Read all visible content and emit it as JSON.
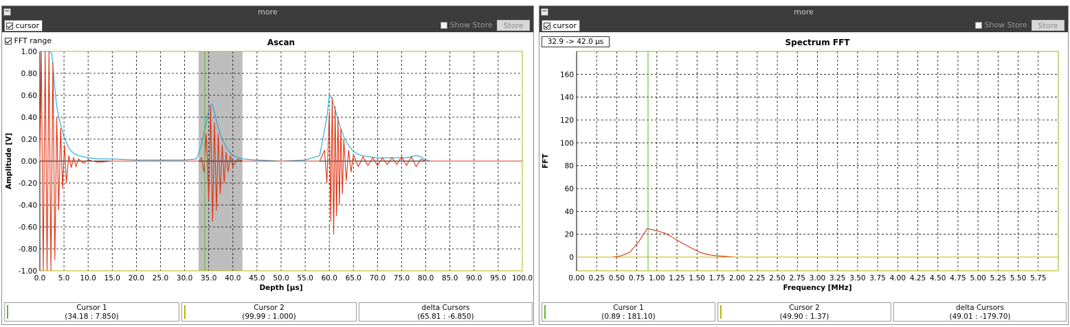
{
  "left_panel": {
    "title": "more",
    "cursor_checkbox": "cursor",
    "show_store": "Show Store",
    "store_button": "Store",
    "fft_range_label": "FFT range",
    "status": [
      {
        "label": "Cursor 1",
        "value": "(34.18 : 7.850)"
      },
      {
        "label": "Cursor 2",
        "value": "(99.99 : 1.000)"
      },
      {
        "label": "delta Cursors",
        "value": "(65.81 : -6.850)"
      }
    ]
  },
  "right_panel": {
    "title": "more",
    "cursor_checkbox": "cursor",
    "show_store": "Show Store",
    "store_button": "Store",
    "range_display": "32.9 -> 42.0 µs",
    "status": [
      {
        "label": "Cursor 1",
        "value": "(0.89 : 181.10)"
      },
      {
        "label": "Cursor 2",
        "value": "(49.90 : 1.37)"
      },
      {
        "label": "delta Cursors",
        "value": "(49.01 : -179.70)"
      }
    ]
  },
  "colors": {
    "trace": "#e03010",
    "envelope": "#1aa7d8",
    "cursor": "#5cb82a",
    "range_shade": "#bdbdbd",
    "frame": "#b7b700"
  },
  "chart_data": [
    {
      "type": "line",
      "title": "Ascan",
      "xlabel": "Depth [µs]",
      "ylabel": "Amplitude [V]",
      "xlim": [
        0,
        100
      ],
      "ylim": [
        -1,
        1
      ],
      "x_ticks": [
        "0.0",
        "5.0",
        "10.0",
        "15.0",
        "20.0",
        "25.0",
        "30.0",
        "35.0",
        "40.0",
        "45.0",
        "50.0",
        "55.0",
        "60.0",
        "65.0",
        "70.0",
        "75.0",
        "80.0",
        "85.0",
        "90.0",
        "95.0",
        "100.0"
      ],
      "y_ticks": [
        "1.00",
        "0.80",
        "0.60",
        "0.40",
        "0.20",
        "0.00",
        "-0.20",
        "-0.40",
        "-0.60",
        "-0.80",
        "-1.00"
      ],
      "grid": true,
      "fft_range": [
        32.9,
        42.0
      ],
      "cursor_x": 34.18,
      "series": [
        {
          "color": "#1aa7d8",
          "x": [
            0,
            1,
            2,
            2.5,
            3,
            3.5,
            4,
            4.5,
            5,
            6,
            7,
            8,
            10,
            12,
            15,
            20,
            25,
            30,
            32.5,
            33.5,
            34.5,
            35.2,
            35.7,
            36.2,
            37,
            38,
            39,
            40,
            42,
            45,
            50,
            55,
            58,
            59.5,
            60,
            60.5,
            61,
            62,
            63,
            64,
            65,
            66,
            68,
            70,
            72,
            74,
            76,
            78,
            79,
            80,
            81,
            85,
            90,
            95,
            100
          ],
          "values": [
            1.0,
            1.0,
            1.0,
            0.98,
            0.7,
            0.5,
            0.38,
            0.3,
            0.22,
            0.12,
            0.07,
            0.05,
            0.03,
            0.02,
            0.02,
            0.01,
            0.01,
            0.01,
            0.02,
            0.15,
            0.35,
            0.5,
            0.52,
            0.45,
            0.3,
            0.18,
            0.1,
            0.05,
            0.02,
            0.01,
            0.0,
            0.01,
            0.05,
            0.4,
            0.6,
            0.58,
            0.5,
            0.35,
            0.22,
            0.14,
            0.09,
            0.06,
            0.04,
            0.03,
            0.03,
            0.03,
            0.03,
            0.05,
            0.04,
            0.01,
            0.0,
            0.0,
            0.0,
            0.0,
            0.0
          ]
        },
        {
          "color": "#e03010",
          "x": [
            0,
            0.3,
            0.7,
            1.1,
            1.5,
            1.9,
            2.3,
            2.7,
            3.1,
            3.5,
            3.9,
            4.3,
            4.7,
            5.1,
            5.5,
            6,
            6.5,
            7,
            7.5,
            8,
            9,
            10,
            12,
            15,
            20,
            25,
            30,
            33,
            33.5,
            34,
            34.5,
            35,
            35.4,
            35.8,
            36.2,
            36.6,
            37,
            37.4,
            37.8,
            38.2,
            38.6,
            39,
            39.5,
            40,
            41,
            42,
            45,
            50,
            55,
            58,
            59,
            59.5,
            60,
            60.3,
            60.6,
            60.9,
            61.2,
            61.5,
            61.8,
            62.1,
            62.4,
            62.7,
            63,
            63.5,
            64,
            64.5,
            65,
            66,
            67,
            68,
            69,
            70,
            71,
            72,
            73,
            74,
            75,
            76,
            77,
            78,
            79,
            80,
            82,
            85,
            90,
            95,
            100
          ],
          "values": [
            0.0,
            1.0,
            -1.0,
            1.0,
            -1.0,
            1.0,
            -1.0,
            0.9,
            -0.9,
            0.4,
            -0.45,
            0.3,
            -0.25,
            0.15,
            -0.2,
            0.05,
            -0.06,
            0.03,
            -0.05,
            0.02,
            -0.02,
            0.01,
            -0.01,
            0.0,
            0.0,
            0.0,
            0.0,
            0.0,
            0.03,
            -0.1,
            0.25,
            -0.35,
            0.5,
            -0.55,
            0.35,
            -0.45,
            0.25,
            -0.3,
            0.15,
            -0.2,
            0.08,
            -0.1,
            0.05,
            -0.05,
            0.02,
            0.0,
            0.0,
            0.0,
            0.0,
            0.0,
            0.1,
            -0.2,
            0.45,
            -0.55,
            0.58,
            -0.67,
            0.5,
            -0.5,
            0.4,
            -0.4,
            0.3,
            -0.3,
            0.2,
            -0.18,
            0.1,
            -0.1,
            0.06,
            -0.05,
            0.04,
            -0.04,
            0.03,
            -0.04,
            0.03,
            -0.03,
            0.03,
            -0.03,
            0.04,
            -0.04,
            0.04,
            -0.05,
            0.02,
            0.0,
            0.0,
            0.0,
            0.0,
            0.0,
            0.0
          ]
        }
      ]
    },
    {
      "type": "line",
      "title": "Spectrum FFT",
      "xlabel": "Frequency [MHz]",
      "ylabel": "FFT",
      "xlim": [
        0,
        6.0
      ],
      "ylim": [
        -12,
        180
      ],
      "x_ticks": [
        "0.00",
        "0.25",
        "0.50",
        "0.75",
        "1.00",
        "1.25",
        "1.50",
        "1.75",
        "2.00",
        "2.25",
        "2.50",
        "2.75",
        "3.00",
        "3.25",
        "3.50",
        "3.75",
        "4.00",
        "4.25",
        "4.50",
        "4.75",
        "5.00",
        "5.25",
        "5.50",
        "5.75"
      ],
      "y_ticks": [
        "0",
        "20",
        "40",
        "60",
        "80",
        "100",
        "120",
        "140",
        "160"
      ],
      "grid": true,
      "cursor_x": 0.89,
      "series": [
        {
          "color": "#e03010",
          "x": [
            0,
            0.11,
            0.22,
            0.33,
            0.44,
            0.55,
            0.66,
            0.77,
            0.88,
            1.0,
            1.1,
            1.2,
            1.32,
            1.43,
            1.54,
            1.65,
            1.76,
            1.87,
            1.98
          ],
          "values": [
            0,
            0,
            0,
            0,
            0,
            1,
            4,
            13,
            25,
            23,
            21,
            17,
            12,
            8,
            4,
            2,
            1,
            0.5,
            0
          ]
        },
        {
          "color": "#b7b700",
          "x": [
            0,
            6.0
          ],
          "values": [
            0,
            0
          ]
        }
      ]
    }
  ]
}
